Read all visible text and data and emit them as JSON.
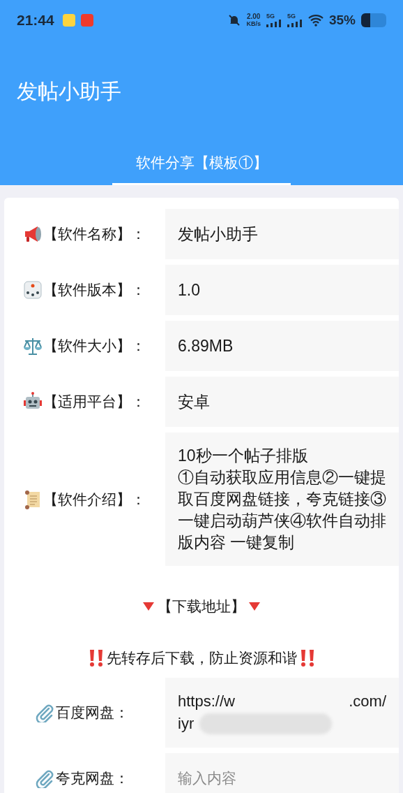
{
  "status_bar": {
    "time": "21:44",
    "net_speed": "2.00",
    "net_unit": "KB/s",
    "signals": [
      "5G",
      "5G"
    ],
    "battery": "35%"
  },
  "app_bar": {
    "title": "发帖小助手"
  },
  "tabs": [
    {
      "label": "软件分享【模板①】",
      "selected": true
    }
  ],
  "fields": [
    {
      "kind": "megaphone",
      "label": "【软件名称】：",
      "value": "发帖小助手"
    },
    {
      "kind": "dice",
      "label": "【软件版本】：",
      "value": "1.0"
    },
    {
      "kind": "scales",
      "label": "【软件大小】：",
      "value": "6.89MB"
    },
    {
      "kind": "robot",
      "label": "【适用平台】：",
      "value": "安卓"
    },
    {
      "kind": "scroll",
      "label": "【软件介绍】：",
      "value": "10秒一个帖子排版\n①自动获取应用信息②一键提取百度网盘链接，夸克链接③一键启动葫芦侠④软件自动排版内容 一键复制"
    }
  ],
  "download_heading": "【下载地址】",
  "warning": "先转存后下载，防止资源和谐",
  "links": [
    {
      "label": "百度网盘：",
      "value_parts": [
        "https://w",
        ".com/",
        "iyr"
      ]
    },
    {
      "label": "夸克网盘：",
      "placeholder": "输入内容"
    }
  ]
}
